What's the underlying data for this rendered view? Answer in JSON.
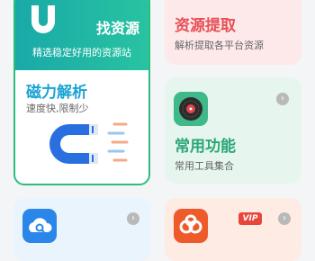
{
  "cards": {
    "find_resources": {
      "title": "找资源",
      "subtitle": "精选稳定好用的资源站",
      "promo_title": "磁力解析",
      "promo_subtitle": "速度快,限制少"
    },
    "resource_extract": {
      "title": "资源提取",
      "subtitle": "解析提取各平台资源"
    },
    "common_tools": {
      "title": "常用功能",
      "subtitle": "常用工具集合"
    },
    "vip_card": {
      "badge": "VIP"
    }
  },
  "icons": [
    "magnet-icon",
    "disc-icon",
    "cloud-search-icon",
    "baidu-cloud-icon",
    "chevron-right-icon"
  ],
  "colors": {
    "green": "#2bbd7e",
    "red": "#e84f57",
    "blue": "#1aa3d3"
  }
}
